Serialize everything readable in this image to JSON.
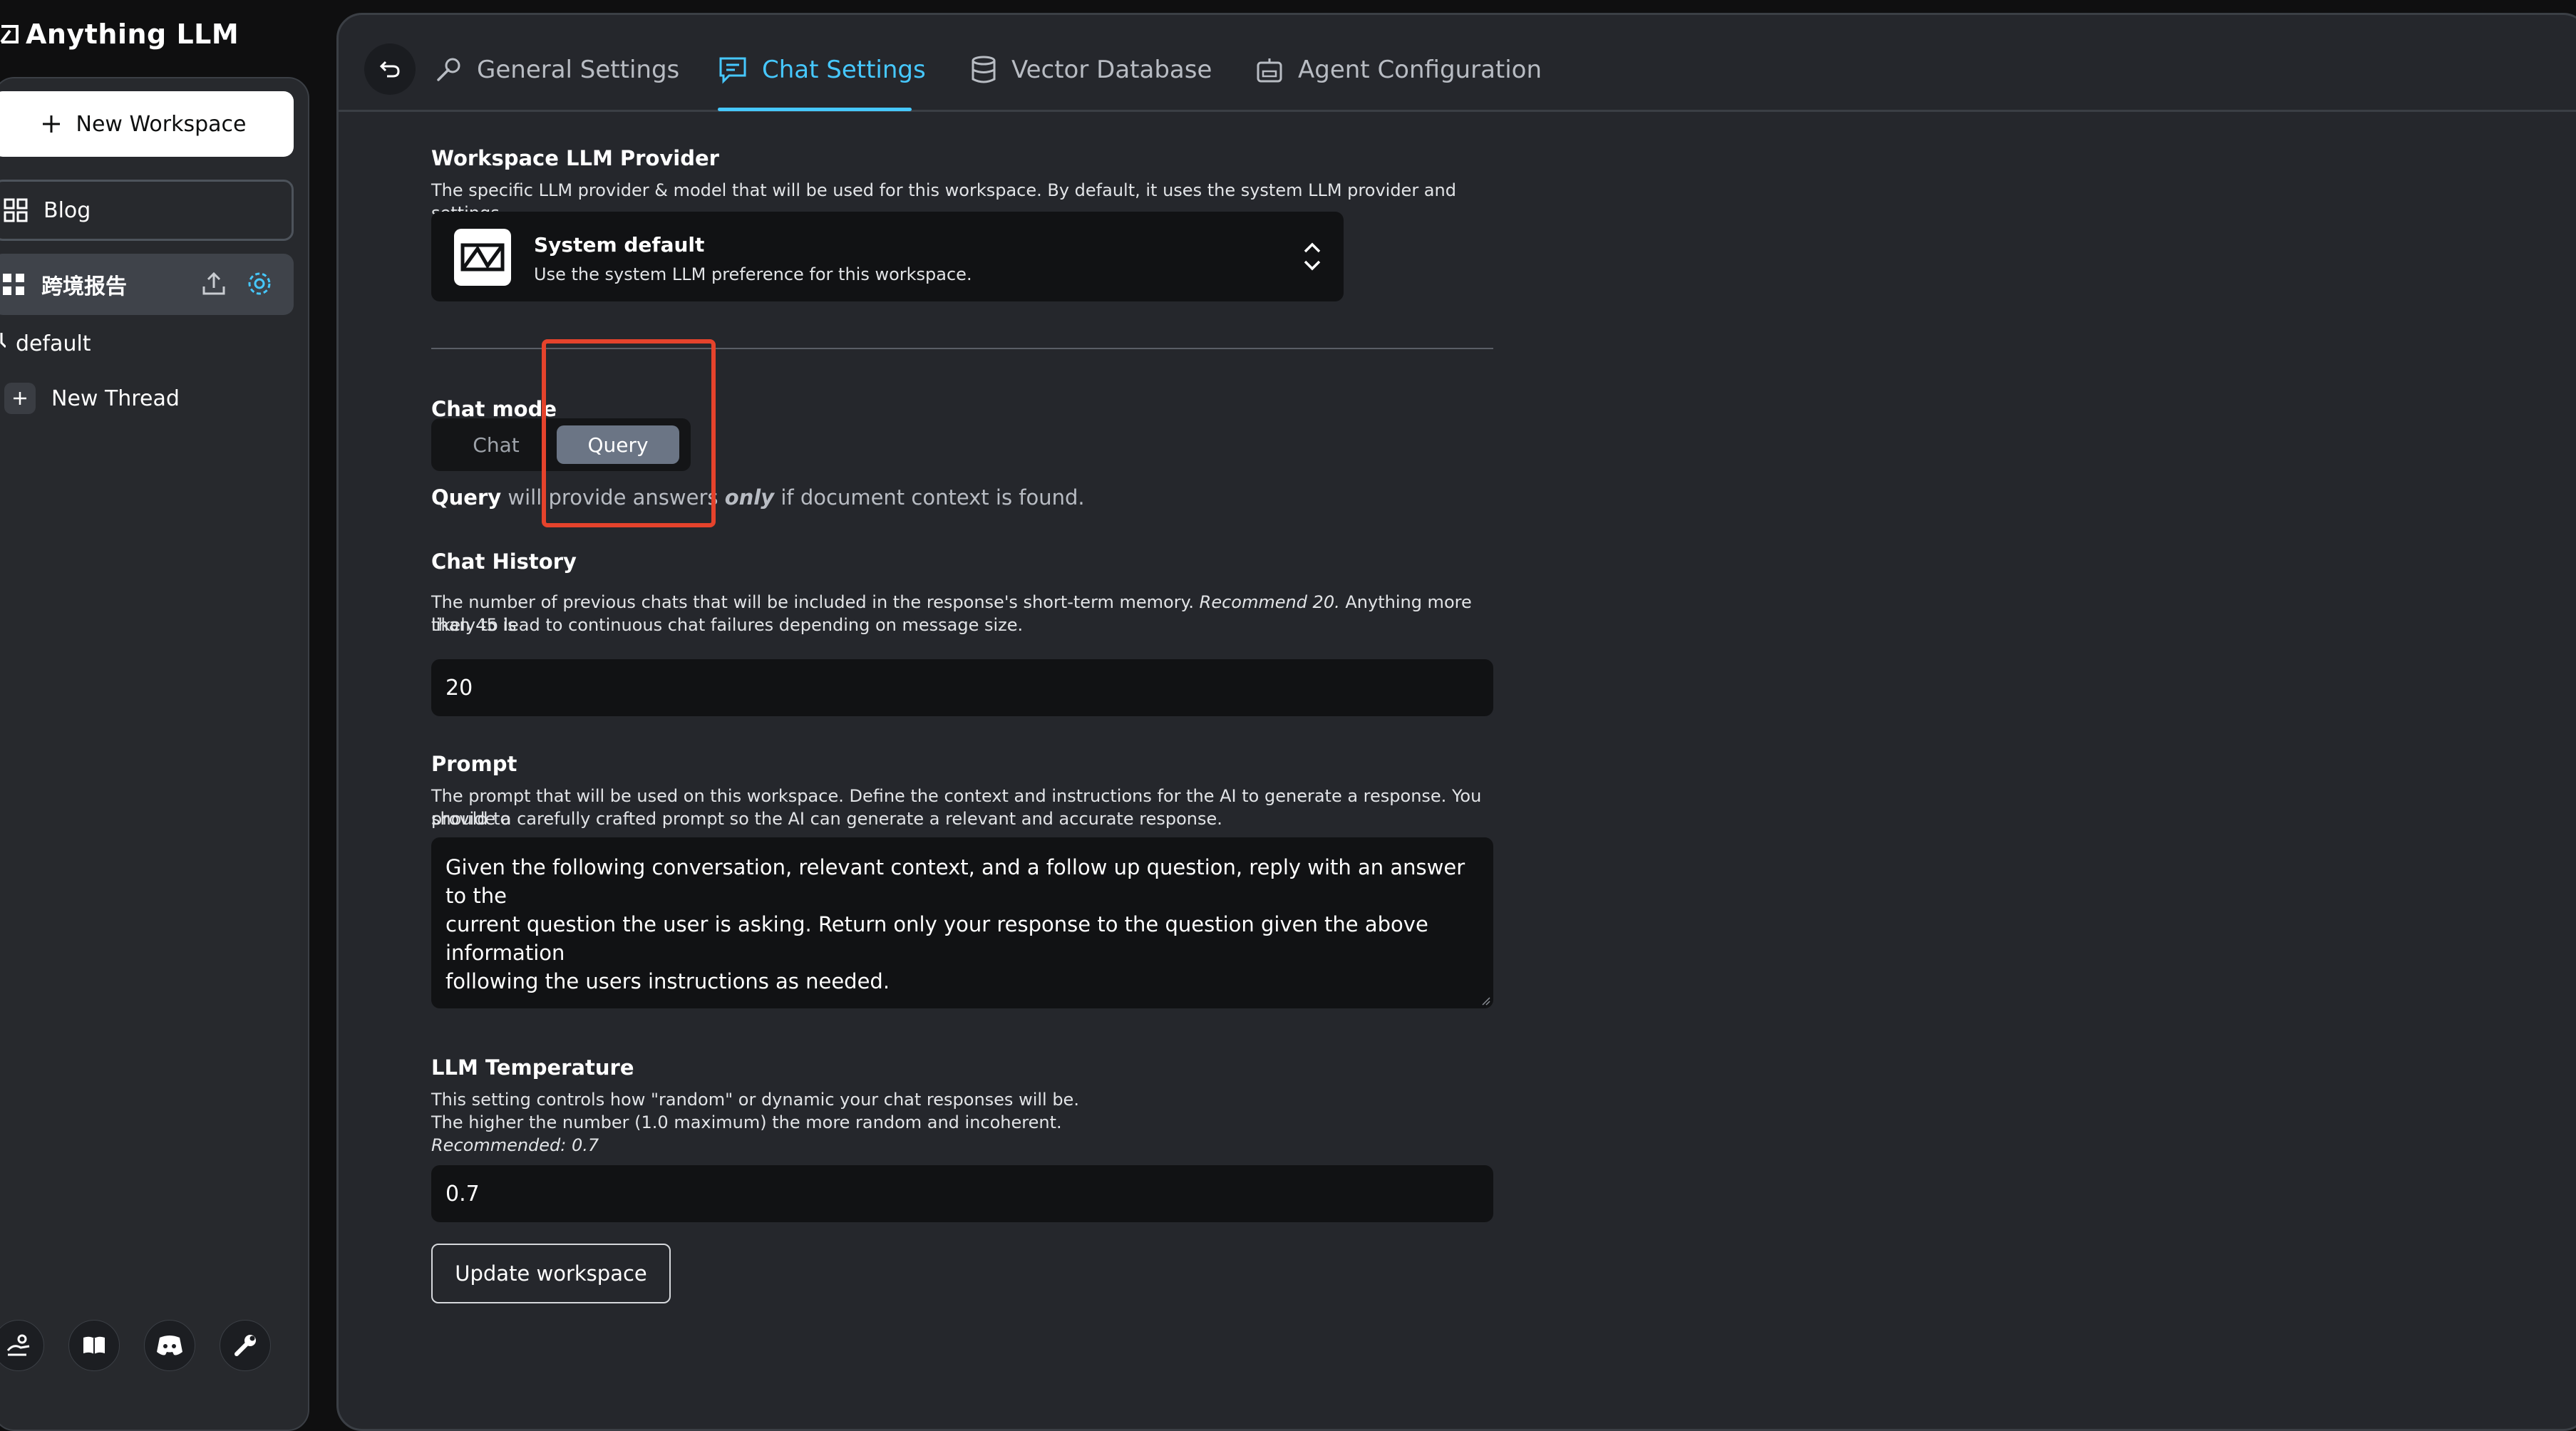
{
  "app": {
    "title": "Anything LLM"
  },
  "sidebar": {
    "new_workspace_label": "New Workspace",
    "workspaces": [
      {
        "label": "Blog"
      },
      {
        "label": "跨境报告"
      }
    ],
    "threads": [
      {
        "label": "default"
      }
    ],
    "new_thread_label": "New Thread",
    "footer_icons": [
      "community-hub-icon",
      "docs-book-icon",
      "discord-icon",
      "settings-wrench-icon"
    ]
  },
  "tabs": [
    {
      "label": "General Settings",
      "icon": "wrench-icon",
      "active": false
    },
    {
      "label": "Chat Settings",
      "icon": "chat-icon",
      "active": true
    },
    {
      "label": "Vector Database",
      "icon": "database-icon",
      "active": false
    },
    {
      "label": "Agent Configuration",
      "icon": "robot-icon",
      "active": false
    }
  ],
  "llm_provider": {
    "title": "Workspace LLM Provider",
    "description": "The specific LLM provider & model that will be used for this workspace. By default, it uses the system LLM provider and settings.",
    "selected_name": "System default",
    "selected_desc": "Use the system LLM preference for this workspace."
  },
  "chat_mode": {
    "title": "Chat mode",
    "options": [
      "Chat",
      "Query"
    ],
    "selected": "Query",
    "note_bold": "Query",
    "note_pre": " will provide answers ",
    "note_em": "only",
    "note_post": " if document context is found."
  },
  "chat_history": {
    "title": "Chat History",
    "desc_1": "The number of previous chats that will be included in the response's short-term memory. ",
    "desc_em": "Recommend 20.",
    "desc_2": " Anything more than 45 is",
    "desc_3": "likely to lead to continuous chat failures depending on message size.",
    "value": "20"
  },
  "prompt": {
    "title": "Prompt",
    "desc_1": "The prompt that will be used on this workspace. Define the context and instructions for the AI to generate a response. You should to",
    "desc_2": "provide a carefully crafted prompt so the AI can generate a relevant and accurate response.",
    "value_1": "Given the following conversation, relevant context, and a follow up question, reply with an answer to the",
    "value_2": "current question the user is asking. Return only your response to the question given the above information",
    "value_3": "following the users instructions as needed."
  },
  "temperature": {
    "title": "LLM Temperature",
    "desc_1": "This setting controls how \"random\" or dynamic your chat responses will be.",
    "desc_2": "The higher the number (1.0 maximum) the more random and incoherent.",
    "desc_3": "Recommended: 0.7",
    "value": "0.7"
  },
  "update_button_label": "Update workspace",
  "colors": {
    "accent": "#46c8ff",
    "highlight_box": "#e5432c",
    "panel_bg": "#25272c",
    "field_bg": "#111214",
    "query_selected": "#6b7585"
  }
}
